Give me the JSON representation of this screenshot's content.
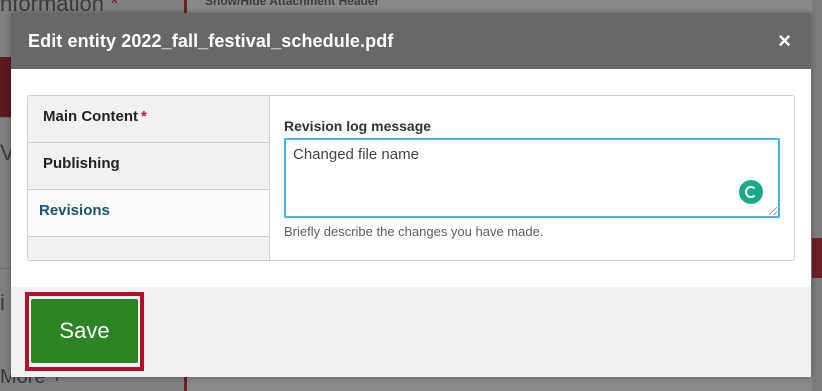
{
  "background": {
    "information_text": "nformation",
    "header_text": "Show/Hide Attachment Header",
    "more_text": "More +",
    "v_text": "V",
    "i_text": "i",
    "required_marker": "*"
  },
  "modal": {
    "title": "Edit entity 2022_fall_festival_schedule.pdf",
    "close_glyph": "×"
  },
  "tabs": [
    {
      "label": "Main Content",
      "required": "*"
    },
    {
      "label": "Publishing"
    },
    {
      "label": "Revisions"
    }
  ],
  "revision": {
    "label": "Revision log message",
    "value": "Changed file name",
    "description": "Briefly describe the changes you have made."
  },
  "footer": {
    "save_label": "Save"
  },
  "colors": {
    "header_bg": "#686868",
    "save_bg": "#2c8424",
    "highlight_border": "#b1102c",
    "focus_border": "#45b3e6",
    "spinner": "#1aa987",
    "active_tab_text": "#1a5377"
  }
}
